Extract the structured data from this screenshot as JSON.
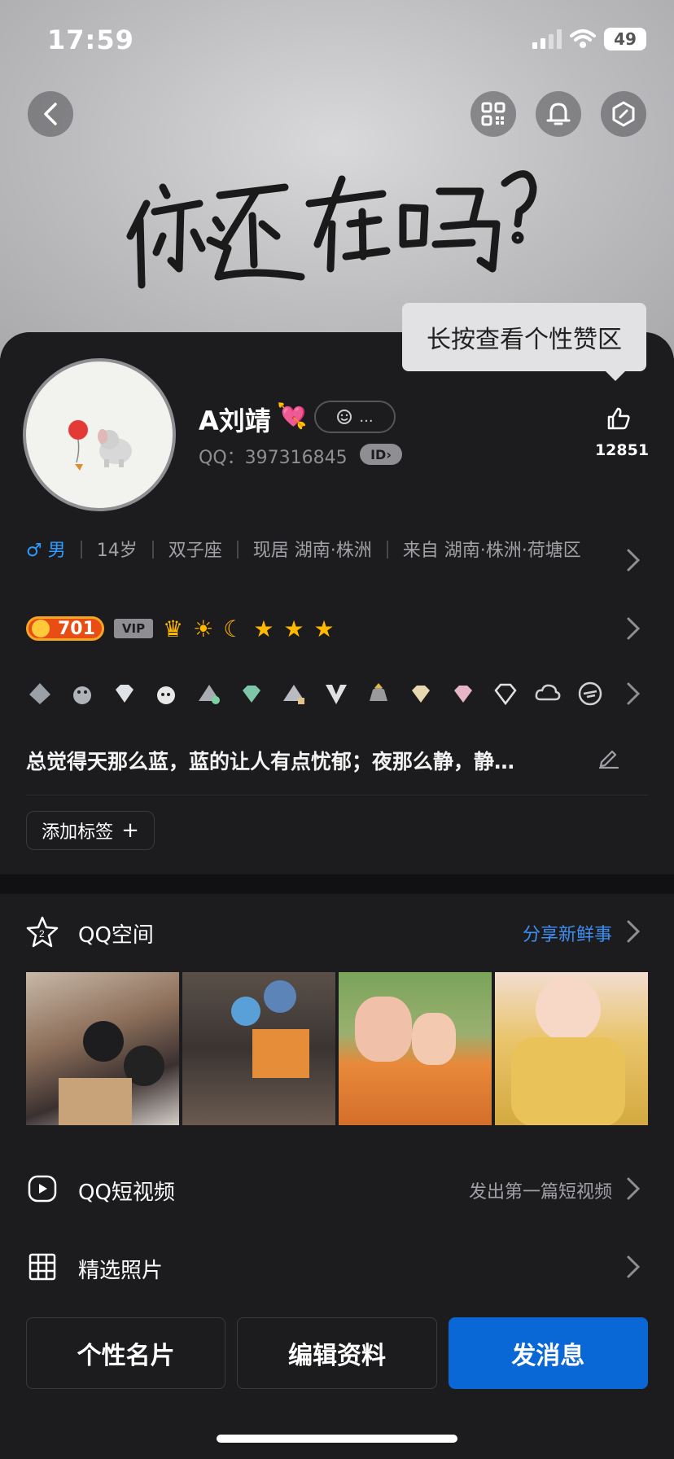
{
  "status": {
    "time": "17:59",
    "battery": "49"
  },
  "cover": {
    "handwriting": "你还在吗?"
  },
  "tooltip": "长按查看个性赞区",
  "profile": {
    "name": "A刘靖",
    "qq_label": "QQ：397316845",
    "id_badge": "ID",
    "likes": "12851",
    "status_pill": "..."
  },
  "info": {
    "gender": "♂ 男",
    "age": "14岁",
    "zodiac": "双子座",
    "current": "现居 湖南·株洲",
    "hometown": "来自 湖南·株洲·荷塘区"
  },
  "level": {
    "value": "701",
    "vip": "VIP"
  },
  "signature": "总觉得天那么蓝，蓝的让人有点忧郁；夜那么静，静…",
  "add_tag": "添加标签",
  "sections": {
    "qzone": {
      "title": "QQ空间",
      "right": "分享新鲜事"
    },
    "video": {
      "title": "QQ短视频",
      "right": "发出第一篇短视频"
    },
    "photos": {
      "title": "精选照片"
    }
  },
  "buttons": {
    "card": "个性名片",
    "edit": "编辑资料",
    "message": "发消息"
  },
  "colors": {
    "accent": "#0a67d6",
    "link": "#3d8ef0",
    "background": "#1c1c1e"
  }
}
